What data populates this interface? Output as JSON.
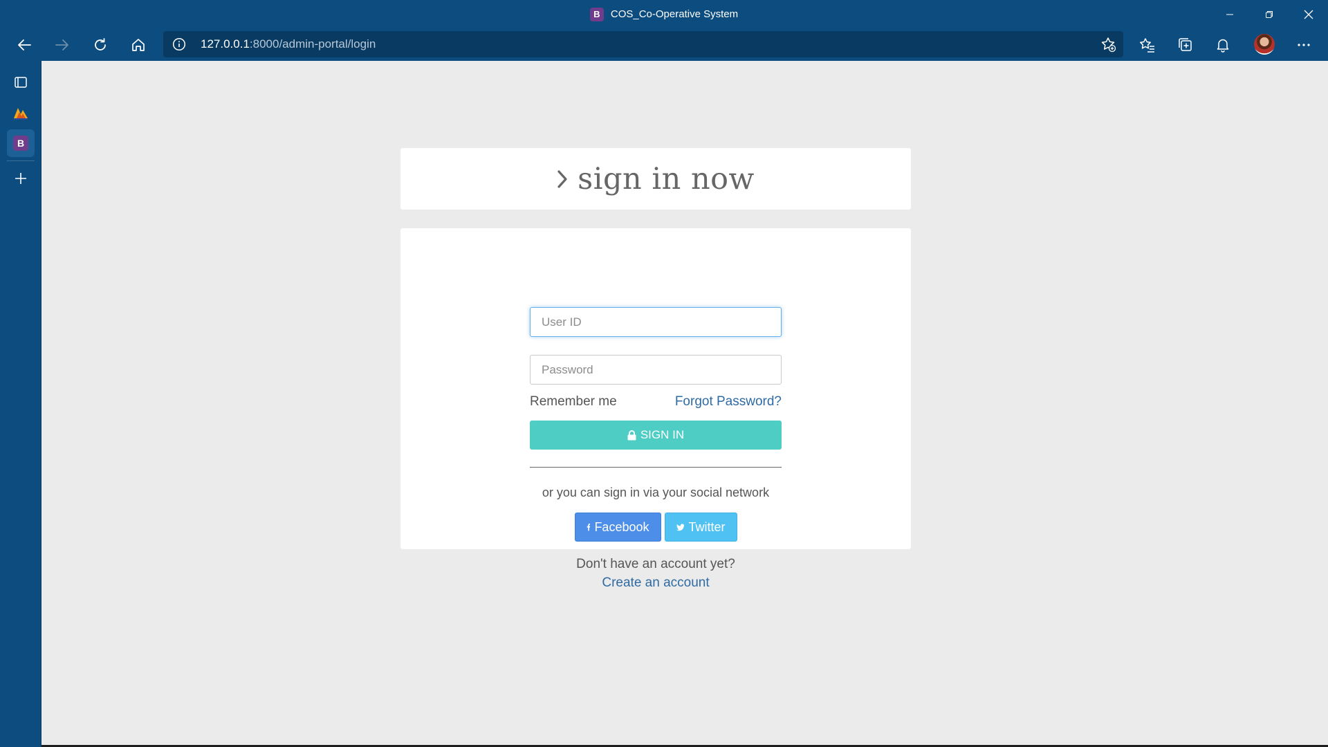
{
  "browser": {
    "window_title": "COS_Co-Operative System",
    "tab_favicon_letter": "B",
    "address": {
      "host": "127.0.0.1",
      "path": ":8000/admin-portal/login"
    },
    "icons": {
      "back": "back-arrow-icon",
      "forward": "forward-arrow-icon",
      "refresh": "refresh-icon",
      "home": "home-icon",
      "info": "info-icon",
      "add_favorite": "add-favorite-icon",
      "favorites": "favorites-icon",
      "collections": "collections-icon",
      "notifications": "bell-icon",
      "more": "more-icon"
    },
    "colors": {
      "chrome": "#0d4c7e",
      "address_bar": "#093a61"
    }
  },
  "sidebar": {
    "items": [
      {
        "name": "tab-actions",
        "icon": "tab-actions-icon"
      },
      {
        "name": "pwa-app",
        "icon": "app-logo-icon"
      },
      {
        "name": "current-tab",
        "label": "B",
        "active": true
      },
      {
        "name": "add-tab",
        "icon": "plus-icon"
      }
    ]
  },
  "login": {
    "heading": "sign in now",
    "user_id_placeholder": "User ID",
    "password_placeholder": "Password",
    "remember_label": "Remember me",
    "forgot_label": "Forgot Password?",
    "sign_in_label": "SIGN IN",
    "social_text": "or you can sign in via your social network",
    "facebook_label": "Facebook",
    "twitter_label": "Twitter",
    "no_account_text": "Don't have an account yet?",
    "create_account_label": "Create an account",
    "colors": {
      "sign_in": "#4ecdc4",
      "facebook": "#4d8ee8",
      "twitter": "#4fc1f2",
      "link": "#2e6aa3"
    }
  }
}
